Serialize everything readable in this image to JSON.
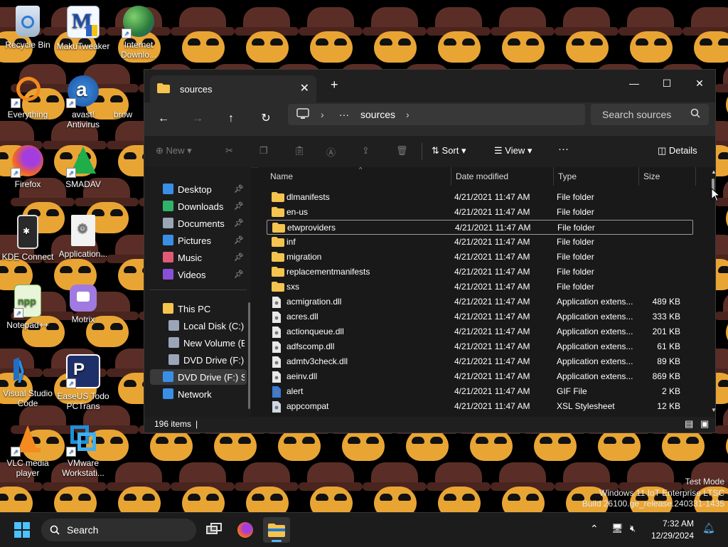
{
  "desktop": {
    "icons": [
      {
        "label": "Recycle Bin"
      },
      {
        "label": "MakuTweaker"
      },
      {
        "label": "Internet Downlo..."
      },
      {
        "label": "Everything"
      },
      {
        "label": "avast! Antivirus"
      },
      {
        "label": "brow"
      },
      {
        "label": "Firefox"
      },
      {
        "label": "SMADAV"
      },
      {
        "label": "KDE Connect"
      },
      {
        "label": "Application..."
      },
      {
        "label": "Notepad++"
      },
      {
        "label": "Motrix"
      },
      {
        "label": "Visual Studio Code"
      },
      {
        "label": "EaseUS Todo PCTrans"
      },
      {
        "label": "VLC media player"
      },
      {
        "label": "VMware Workstati..."
      }
    ]
  },
  "explorer": {
    "tab_title": "sources",
    "new_tab": "+",
    "address": {
      "ellipsis": "···",
      "current": "sources"
    },
    "search_placeholder": "Search sources",
    "commands": {
      "new": "New",
      "sort": "Sort",
      "view": "View",
      "more": "···",
      "details": "Details"
    },
    "nav": [
      {
        "label": "Desktop",
        "pinned": true
      },
      {
        "label": "Downloads",
        "pinned": true
      },
      {
        "label": "Documents",
        "pinned": true
      },
      {
        "label": "Pictures",
        "pinned": true
      },
      {
        "label": "Music",
        "pinned": true
      },
      {
        "label": "Videos",
        "pinned": true
      },
      {
        "label": "This PC"
      },
      {
        "label": "Local Disk (C:)"
      },
      {
        "label": "New Volume (E:"
      },
      {
        "label": "DVD Drive (F:) S"
      },
      {
        "label": "DVD Drive (F:) SSS"
      },
      {
        "label": "Network"
      }
    ],
    "columns": {
      "name": "Name",
      "date": "Date modified",
      "type": "Type",
      "size": "Size"
    },
    "files": [
      {
        "name": "dlmanifests",
        "date": "4/21/2021 11:47 AM",
        "type": "File folder",
        "size": "",
        "kind": "folder"
      },
      {
        "name": "en-us",
        "date": "4/21/2021 11:47 AM",
        "type": "File folder",
        "size": "",
        "kind": "folder"
      },
      {
        "name": "etwproviders",
        "date": "4/21/2021 11:47 AM",
        "type": "File folder",
        "size": "",
        "kind": "folder"
      },
      {
        "name": "inf",
        "date": "4/21/2021 11:47 AM",
        "type": "File folder",
        "size": "",
        "kind": "folder"
      },
      {
        "name": "migration",
        "date": "4/21/2021 11:47 AM",
        "type": "File folder",
        "size": "",
        "kind": "folder"
      },
      {
        "name": "replacementmanifests",
        "date": "4/21/2021 11:47 AM",
        "type": "File folder",
        "size": "",
        "kind": "folder"
      },
      {
        "name": "sxs",
        "date": "4/21/2021 11:47 AM",
        "type": "File folder",
        "size": "",
        "kind": "folder"
      },
      {
        "name": "acmigration.dll",
        "date": "4/21/2021 11:47 AM",
        "type": "Application extens...",
        "size": "489 KB",
        "kind": "dll"
      },
      {
        "name": "acres.dll",
        "date": "4/21/2021 11:47 AM",
        "type": "Application extens...",
        "size": "333 KB",
        "kind": "dll"
      },
      {
        "name": "actionqueue.dll",
        "date": "4/21/2021 11:47 AM",
        "type": "Application extens...",
        "size": "201 KB",
        "kind": "dll"
      },
      {
        "name": "adfscomp.dll",
        "date": "4/21/2021 11:47 AM",
        "type": "Application extens...",
        "size": "61 KB",
        "kind": "dll"
      },
      {
        "name": "admtv3check.dll",
        "date": "4/21/2021 11:47 AM",
        "type": "Application extens...",
        "size": "89 KB",
        "kind": "dll"
      },
      {
        "name": "aeinv.dll",
        "date": "4/21/2021 11:47 AM",
        "type": "Application extens...",
        "size": "869 KB",
        "kind": "dll"
      },
      {
        "name": "alert",
        "date": "4/21/2021 11:47 AM",
        "type": "GIF File",
        "size": "2 KB",
        "kind": "gif"
      },
      {
        "name": "appcompat",
        "date": "4/21/2021 11:47 AM",
        "type": "XSL Stylesheet",
        "size": "12 KB",
        "kind": "xsl"
      }
    ],
    "status": "196 items"
  },
  "watermark": {
    "line1": "Test Mode",
    "line2": "Windows 11 IoT Enterprise LTSC",
    "line3": "Build 26100.ge_release.240331-1435"
  },
  "taskbar": {
    "search": "Search",
    "time": "7:32 AM",
    "date": "12/29/2024"
  }
}
